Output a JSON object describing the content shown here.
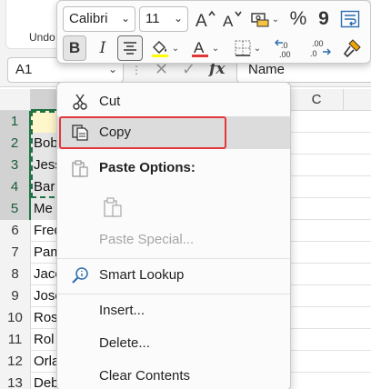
{
  "ribbon": {
    "undo_label": "Undo"
  },
  "formula_bar": {
    "name_box": "A1",
    "formula_value": "Name",
    "fx_label": "fx"
  },
  "grid": {
    "columns": [
      "C"
    ],
    "rows": [
      {
        "num": "1",
        "a": ""
      },
      {
        "num": "2",
        "a": "Bob"
      },
      {
        "num": "3",
        "a": "Jess"
      },
      {
        "num": "4",
        "a": "Bar"
      },
      {
        "num": "5",
        "a": "Me"
      },
      {
        "num": "6",
        "a": "Fred"
      },
      {
        "num": "7",
        "a": "Pam"
      },
      {
        "num": "8",
        "a": "Jaco"
      },
      {
        "num": "9",
        "a": "Jose"
      },
      {
        "num": "10",
        "a": "Ros"
      },
      {
        "num": "11",
        "a": "Rol"
      },
      {
        "num": "12",
        "a": "Orla"
      },
      {
        "num": "13",
        "a": "Deb"
      }
    ]
  },
  "mini_toolbar": {
    "font_name": "Calibri",
    "font_size": "11",
    "comma_glyph": "9",
    "percent_glyph": "%",
    "bold_label": "B",
    "italic_label": "I",
    "font_color_letter": "A",
    "font_color": "#e0373b",
    "icons": [
      "increase-font-icon",
      "decrease-font-icon",
      "number-format-icon",
      "percent-icon",
      "comma-style-icon",
      "wrap-text-icon",
      "bold-icon",
      "italic-icon",
      "align-center-icon",
      "fill-color-icon",
      "font-color-icon",
      "borders-icon",
      "increase-decimal-icon",
      "decrease-decimal-icon",
      "format-painter-icon"
    ]
  },
  "context_menu": {
    "cut": "Cut",
    "copy": "Copy",
    "paste_options": "Paste Options:",
    "paste_special": "Paste Special...",
    "smart_lookup": "Smart Lookup",
    "insert": "Insert...",
    "delete": "Delete...",
    "clear_contents": "Clear Contents",
    "highlight_color": "#e0373b"
  },
  "colors": {
    "accent_green": "#217346",
    "highlight_red": "#e0373b"
  }
}
